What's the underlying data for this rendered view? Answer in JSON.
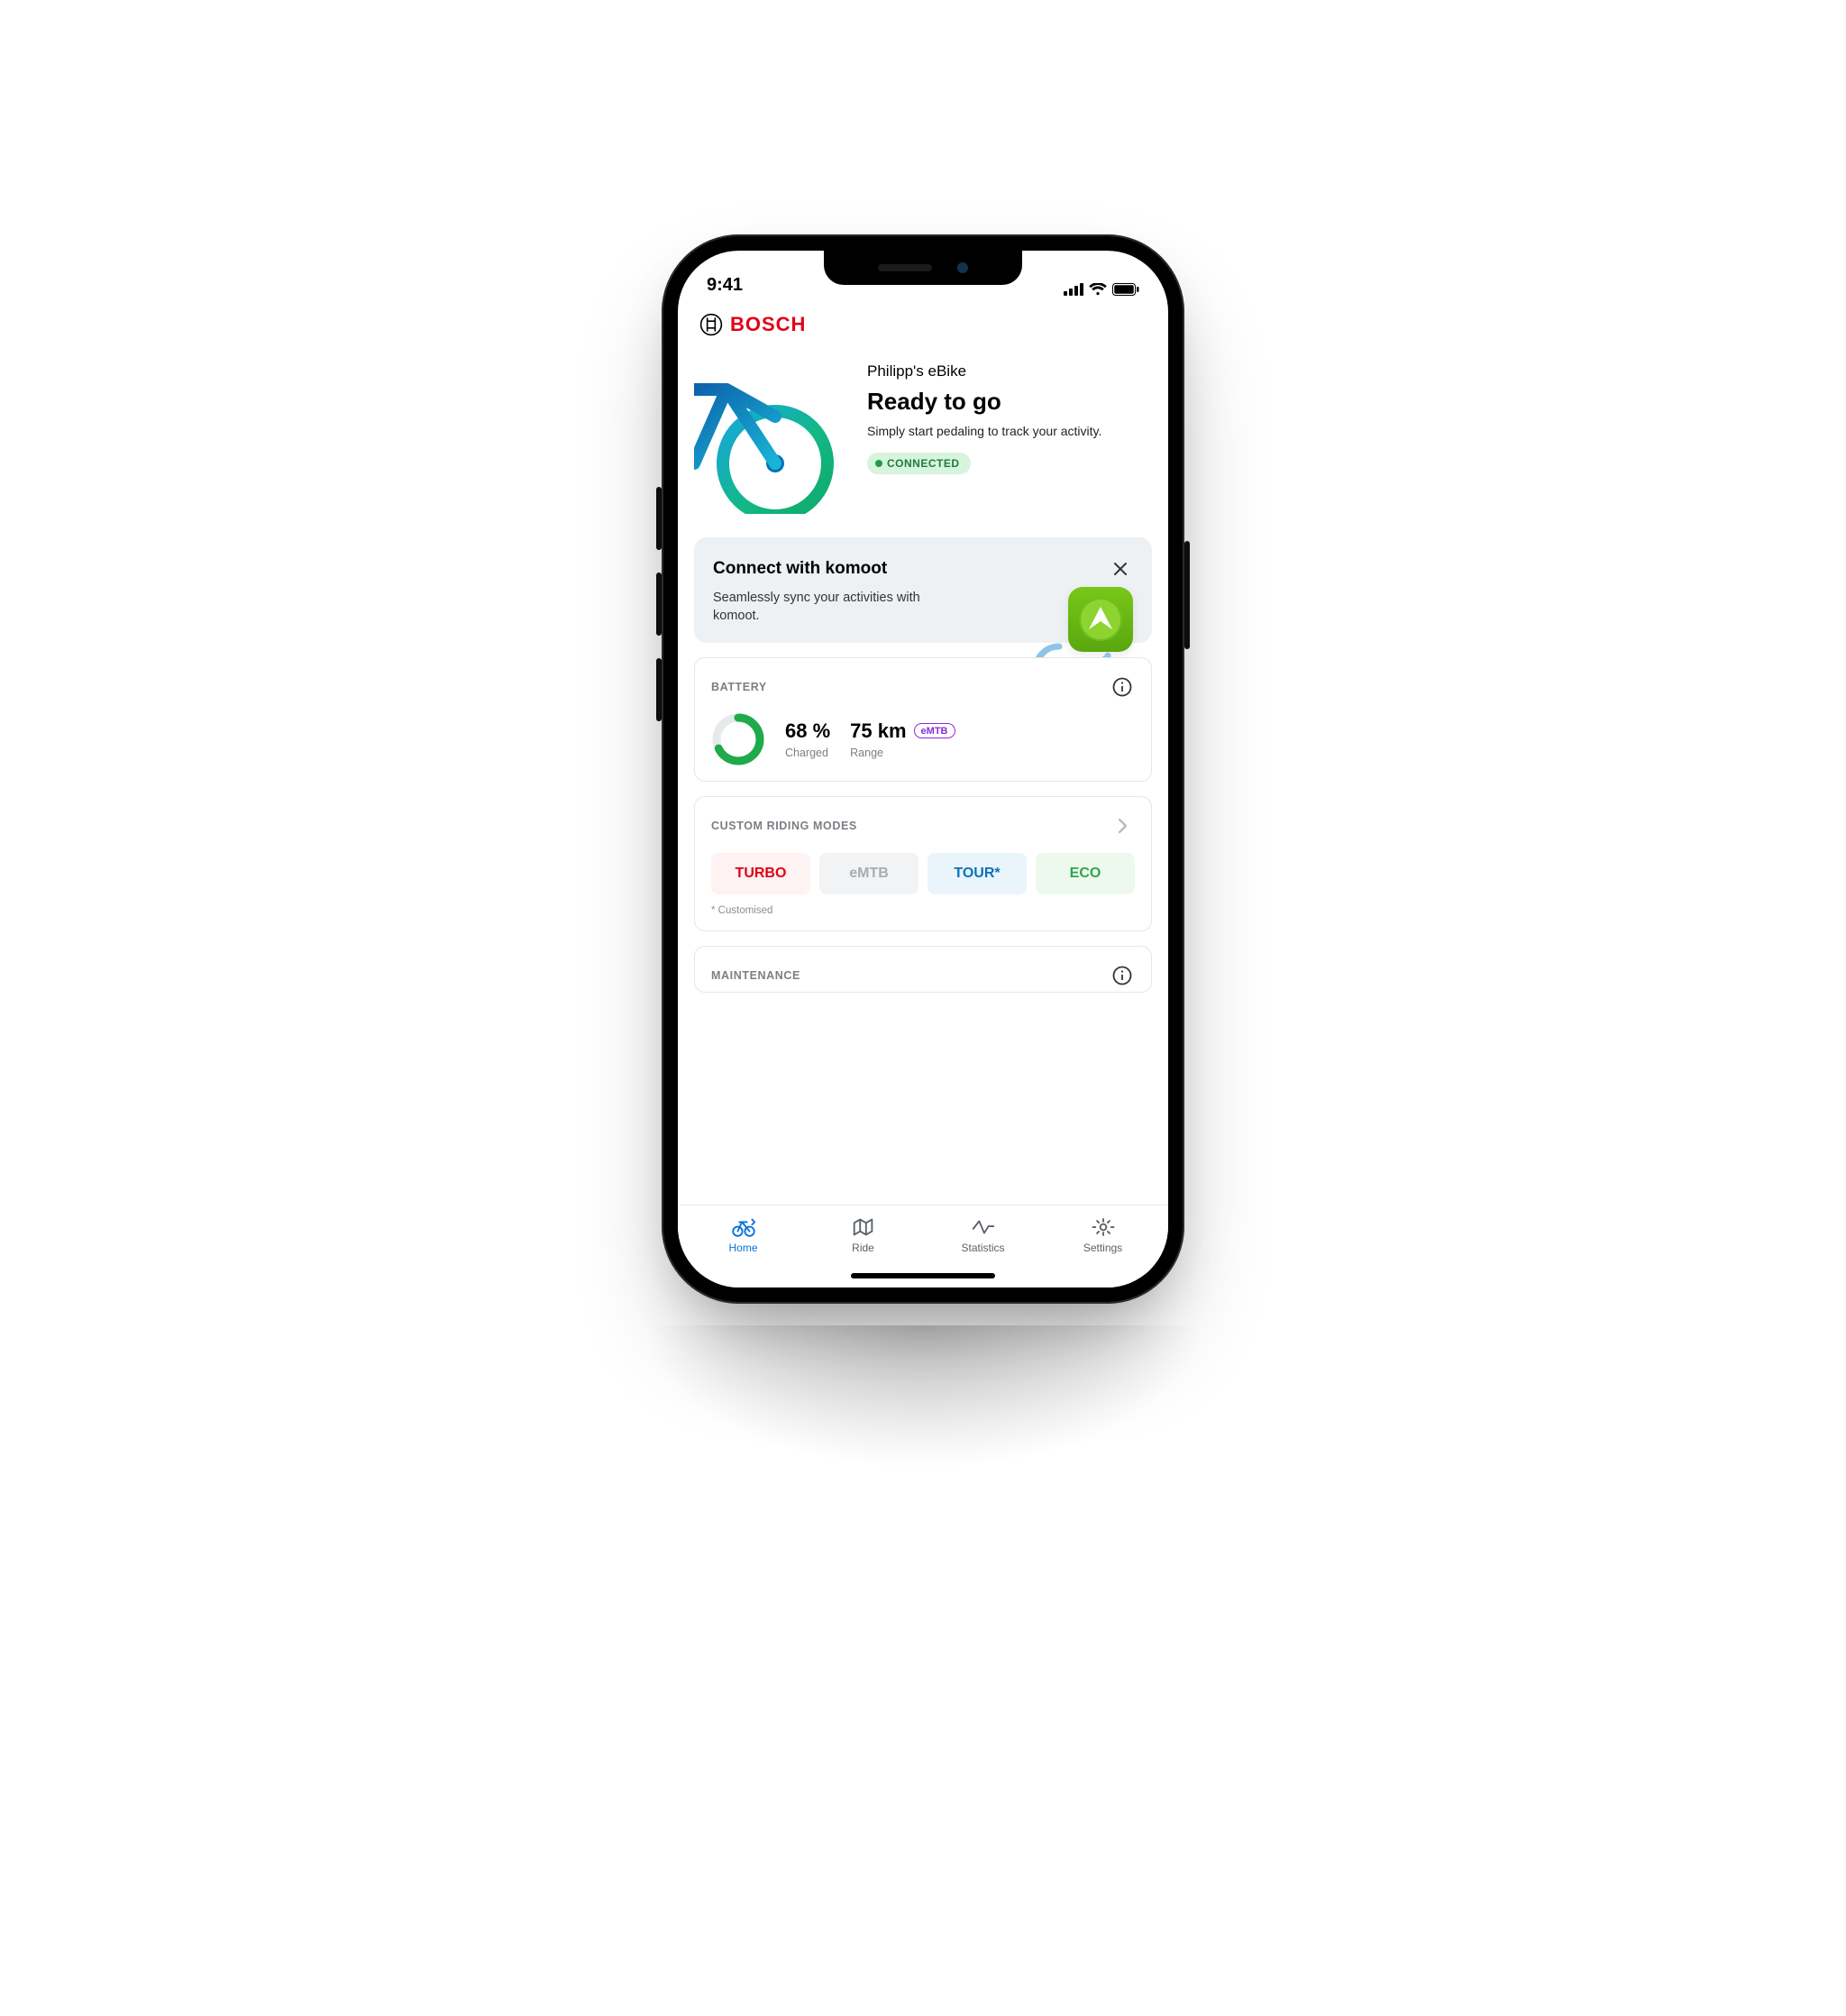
{
  "status_bar": {
    "time": "9:41"
  },
  "header": {
    "brand": "BOSCH"
  },
  "hero": {
    "name": "Philipp's eBike",
    "title": "Ready to go",
    "subtitle": "Simply start pedaling to track your activity.",
    "status": "CONNECTED"
  },
  "komoot": {
    "title": "Connect with komoot",
    "description": "Seamlessly sync your activities with komoot."
  },
  "battery": {
    "section_label": "BATTERY",
    "percent_value": "68 %",
    "percent_label": "Charged",
    "percent_number": 68,
    "range_value": "75 km",
    "range_label": "Range",
    "range_mode_tag": "eMTB"
  },
  "riding_modes": {
    "section_label": "CUSTOM RIDING MODES",
    "modes": {
      "turbo": "TURBO",
      "emtb": "eMTB",
      "tour": "TOUR*",
      "eco": "ECO"
    },
    "footnote": "* Customised"
  },
  "maintenance": {
    "section_label": "MAINTENANCE"
  },
  "tabs": {
    "home": "Home",
    "ride": "Ride",
    "stats": "Statistics",
    "settings": "Settings"
  }
}
